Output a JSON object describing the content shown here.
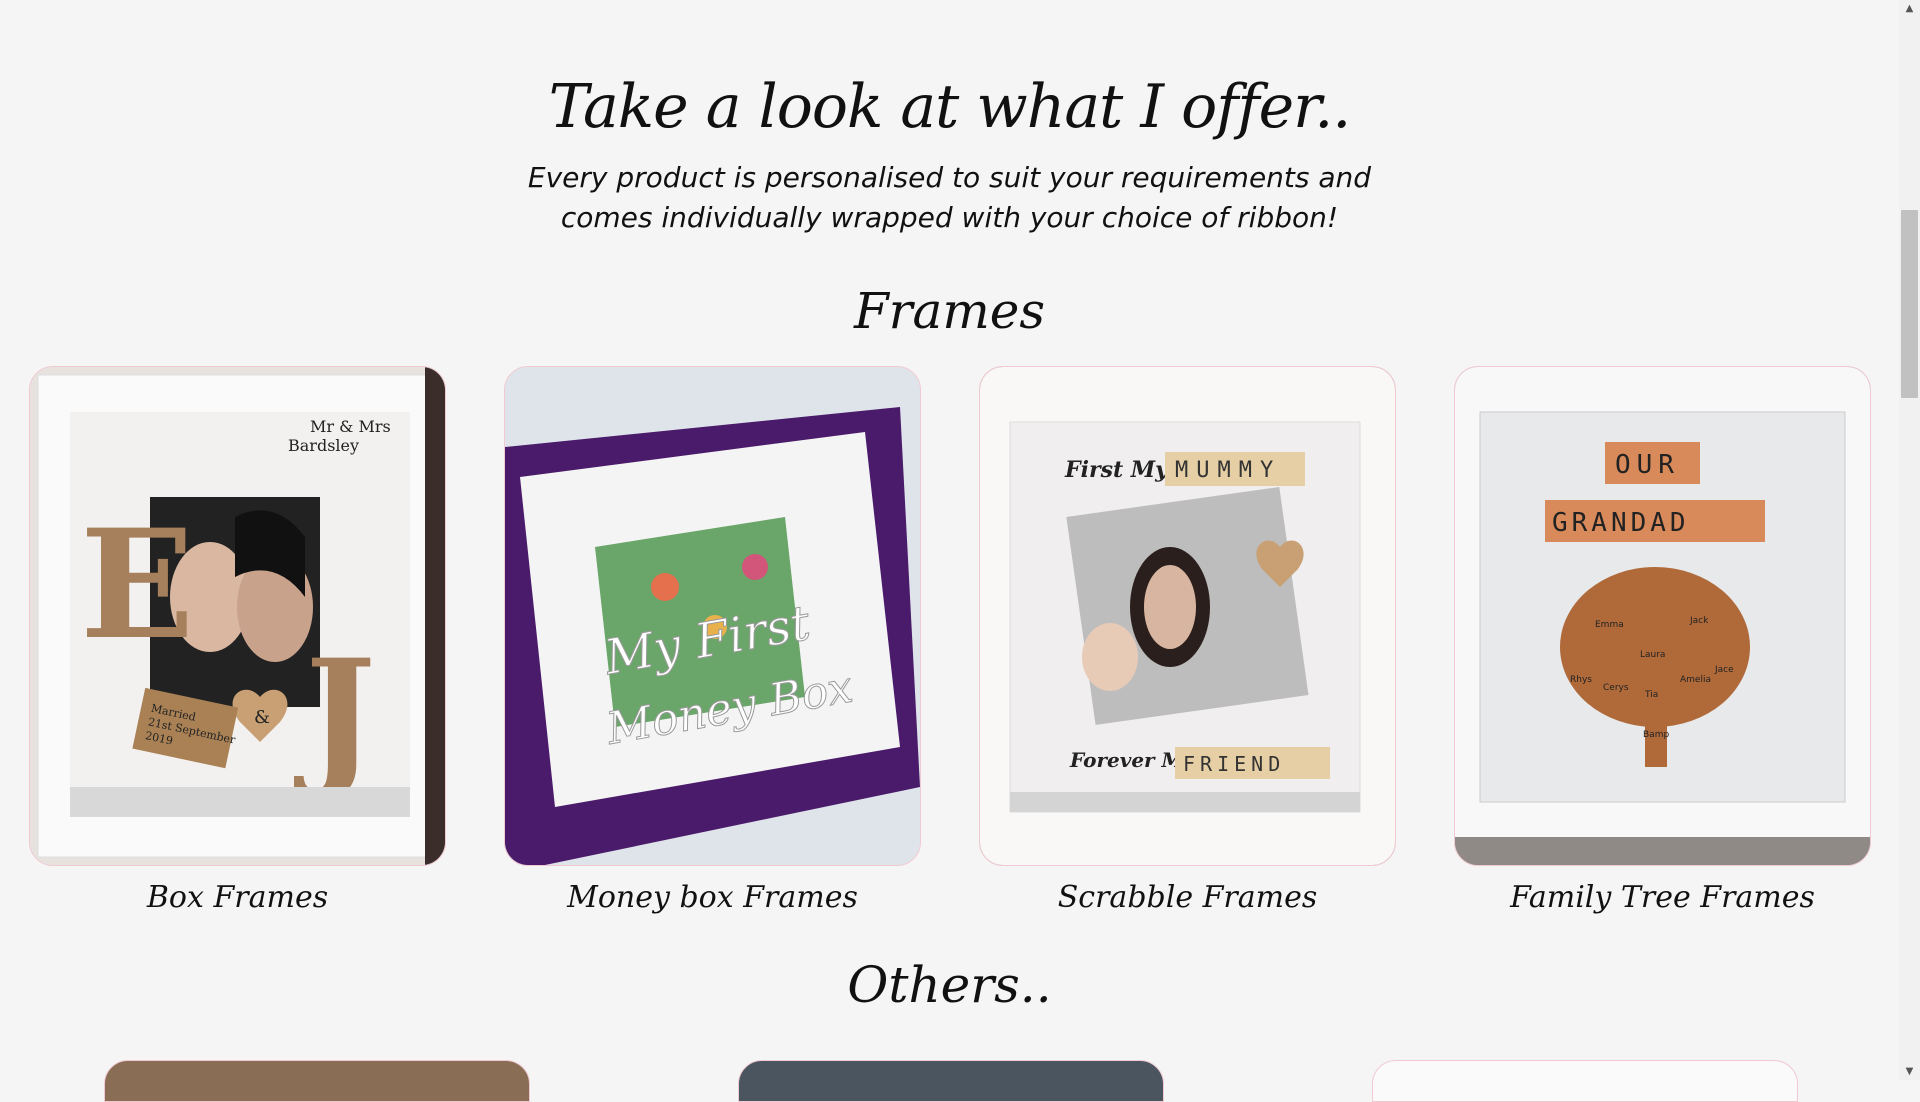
{
  "header": {
    "title": "Take a look at what I offer..",
    "intro_line1": "Every product is personalised to suit your requirements and",
    "intro_line2": "comes individually wrapped with your choice of ribbon!"
  },
  "sections": {
    "frames_title": "Frames",
    "others_title": "Others.."
  },
  "products": [
    {
      "label": "Box Frames",
      "image_text_1": "Mr & Mrs",
      "image_text_2": "Bardsley",
      "image_text_3": "E",
      "image_text_4": "J",
      "image_text_5": "&",
      "tag_line1": "Married",
      "tag_line2": "21st September",
      "tag_line3": "2019"
    },
    {
      "label": "Money box Frames",
      "image_text_1": "My First",
      "image_text_2": "Money Box"
    },
    {
      "label": "Scrabble Frames",
      "image_text_1": "First My",
      "image_text_2": "MUMMY",
      "image_text_3": "Forever My",
      "image_text_4": "FRIEND"
    },
    {
      "label": "Family Tree Frames",
      "image_text_1": "OUR",
      "image_text_2": "GRANDAD",
      "names": [
        "Emma",
        "Jack",
        "Laura",
        "Rhys",
        "Cerys",
        "Tia",
        "Amelia",
        "Jace",
        "Bamp"
      ]
    }
  ],
  "colors": {
    "background": "#f5f5f5",
    "card_border": "#f0c9d2",
    "text": "#111111"
  }
}
